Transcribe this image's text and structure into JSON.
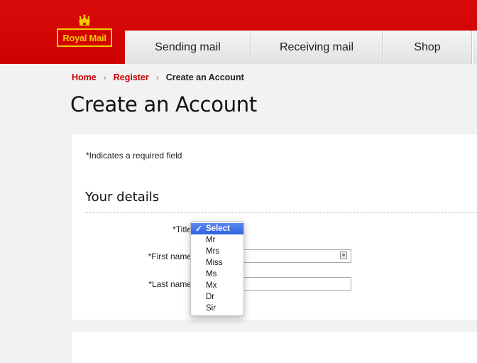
{
  "header": {
    "logo_text": "Royal Mail",
    "nav": [
      "Sending mail",
      "Receiving mail",
      "Shop"
    ]
  },
  "breadcrumb": {
    "home": "Home",
    "register": "Register",
    "current": "Create an Account",
    "separator": "›"
  },
  "page_title": "Create an Account",
  "form": {
    "required_note": "*Indicates a required field",
    "section_title": "Your details",
    "title_label": "*Title",
    "first_name_label": "*First name",
    "last_name_label": "*Last name",
    "first_name_value": "",
    "last_name_value": "",
    "title_options": [
      "Select",
      "Mr",
      "Mrs",
      "Miss",
      "Ms",
      "Mx",
      "Dr",
      "Sir"
    ],
    "title_selected": "Select"
  },
  "colors": {
    "brand_red": "#d40000",
    "logo_yellow": "#f6c800",
    "link_red": "#c40000",
    "selection_blue": "#3d6fe6"
  }
}
